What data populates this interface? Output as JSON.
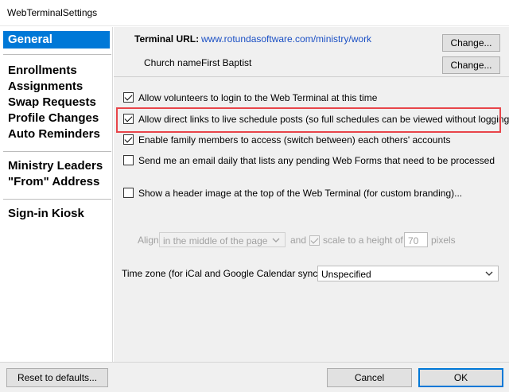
{
  "window": {
    "title": "WebTerminalSettings"
  },
  "sidebar": {
    "selected": "General",
    "items": [
      "General",
      "Enrollments",
      "Assignments",
      "Swap Requests",
      "Profile Changes",
      "Auto Reminders",
      "Ministry Leaders",
      "\"From\" Address",
      "Sign-in Kiosk"
    ]
  },
  "terminal": {
    "url_label": "Terminal URL:",
    "url_value": "www.rotundasoftware.com/ministry/work",
    "church_label": "Church name:",
    "church_value": "First Baptist",
    "change_label": "Change..."
  },
  "options": [
    {
      "label": "Allow volunteers to login to the Web Terminal at this time",
      "checked": true
    },
    {
      "label": "Allow direct links to live schedule posts (so full schedules can be viewed without logging in)",
      "checked": true
    },
    {
      "label": "Enable family members to access (switch between) each others' accounts",
      "checked": true
    },
    {
      "label": "Send me an email daily that lists any pending Web Forms that need to be processed",
      "checked": false
    },
    {
      "label": "Show a header image at the top of the Web Terminal (for custom branding)...",
      "checked": false
    }
  ],
  "header_image": {
    "align_label": "Align",
    "align_value": "in the middle of the page",
    "and_label": "and",
    "scale_label": "scale to a height of",
    "scale_checked": true,
    "height_value": "70",
    "pixels_label": "pixels"
  },
  "timezone": {
    "label": "Time zone (for iCal and Google Calendar synchs):",
    "value": "Unspecified"
  },
  "footer": {
    "reset_label": "Reset to defaults...",
    "cancel_label": "Cancel",
    "ok_label": "OK"
  },
  "colors": {
    "selection": "#0078d7",
    "link": "#1a4fc4",
    "highlight_box": "#e8454a"
  }
}
